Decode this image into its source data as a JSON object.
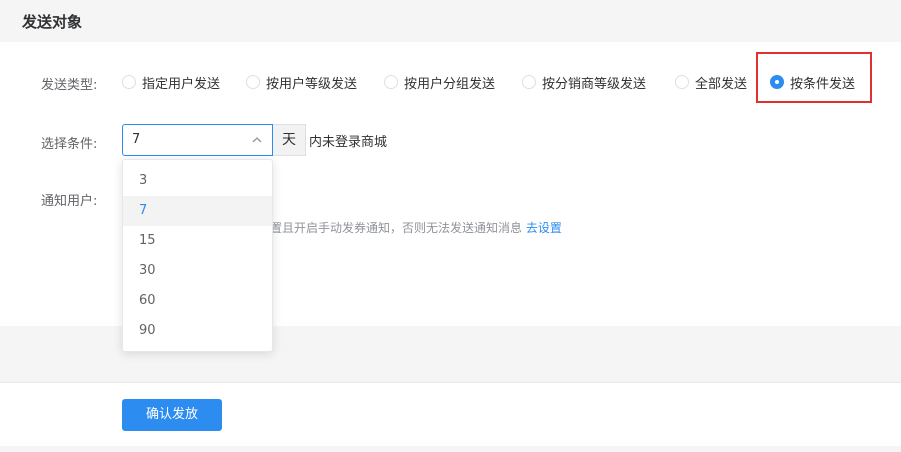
{
  "section": {
    "title": "发送对象"
  },
  "send_type": {
    "label": "发送类型:",
    "options": [
      {
        "label": "指定用户发送",
        "checked": false
      },
      {
        "label": "按用户等级发送",
        "checked": false
      },
      {
        "label": "按用户分组发送",
        "checked": false
      },
      {
        "label": "按分销商等级发送",
        "checked": false
      },
      {
        "label": "全部发送",
        "checked": false
      },
      {
        "label": "按条件发送",
        "checked": true
      }
    ]
  },
  "condition": {
    "label": "选择条件:",
    "selected_value": "7",
    "addon": "天",
    "suffix_text": "内未登录商城",
    "dropdown_options": [
      "3",
      "7",
      "15",
      "30",
      "60",
      "90"
    ]
  },
  "notify": {
    "label": "通知用户:",
    "hint_text": "置且开启手动发券通知，否则无法发送通知消息",
    "hint_link": "去设置"
  },
  "actions": {
    "confirm_label": "确认发放"
  },
  "colors": {
    "accent": "#2d8cf0",
    "highlight": "#e03131"
  }
}
